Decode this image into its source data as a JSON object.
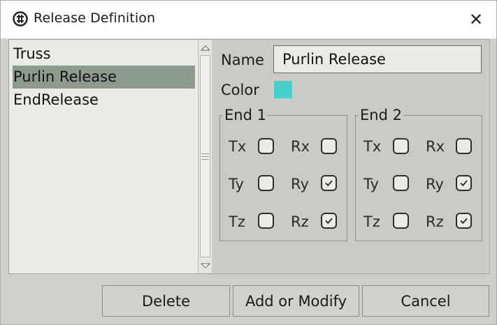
{
  "window": {
    "title": "Release Definition",
    "close_glyph": "✕"
  },
  "release_list": {
    "items": [
      {
        "label": "Truss",
        "selected": false
      },
      {
        "label": "Purlin Release",
        "selected": true
      },
      {
        "label": "EndRelease",
        "selected": false
      }
    ]
  },
  "properties": {
    "name_label": "Name",
    "name_value": "Purlin Release",
    "color_label": "Color",
    "color_value": "#48d1cc"
  },
  "end1": {
    "legend": "End 1",
    "tx": {
      "label": "Tx",
      "checked": false
    },
    "rx": {
      "label": "Rx",
      "checked": false
    },
    "ty": {
      "label": "Ty",
      "checked": false
    },
    "ry": {
      "label": "Ry",
      "checked": true
    },
    "tz": {
      "label": "Tz",
      "checked": false
    },
    "rz": {
      "label": "Rz",
      "checked": true
    }
  },
  "end2": {
    "legend": "End 2",
    "tx": {
      "label": "Tx",
      "checked": false
    },
    "rx": {
      "label": "Rx",
      "checked": false
    },
    "ty": {
      "label": "Ty",
      "checked": false
    },
    "ry": {
      "label": "Ry",
      "checked": true
    },
    "tz": {
      "label": "Tz",
      "checked": false
    },
    "rz": {
      "label": "Rz",
      "checked": true
    }
  },
  "buttons": {
    "delete": "Delete",
    "add_modify": "Add or Modify",
    "cancel": "Cancel"
  }
}
